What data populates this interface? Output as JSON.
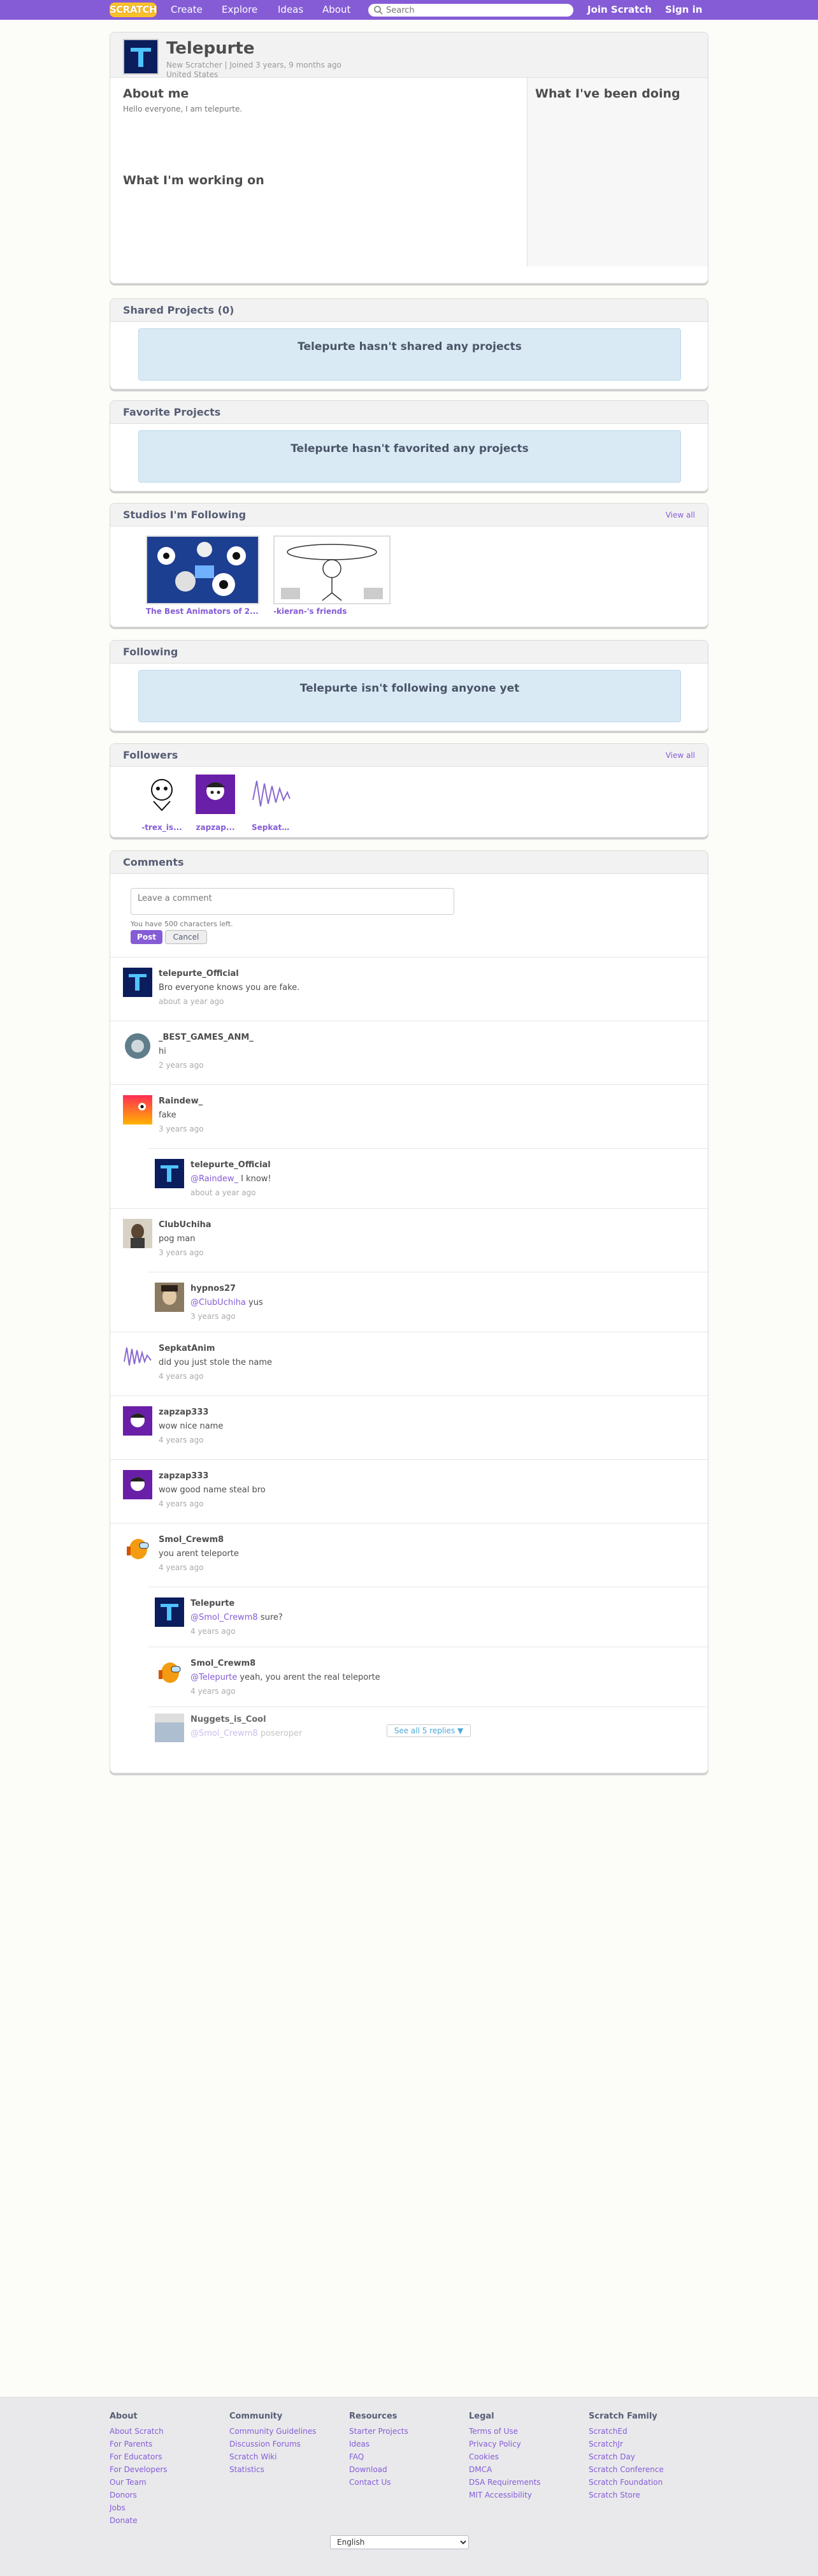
{
  "nav": {
    "logo": "SCRATCH",
    "create": "Create",
    "explore": "Explore",
    "ideas": "Ideas",
    "about": "About",
    "search_placeholder": "Search",
    "join": "Join Scratch",
    "signin": "Sign in"
  },
  "profile": {
    "username": "Telepurte",
    "status": "New Scratcher",
    "joined": "Joined 3 years, 9 months ago",
    "country": "United States",
    "about_title": "About me",
    "about_text": "Hello everyone, I am telepurte.",
    "working_title": "What I'm working on",
    "doing_title": "What I've been doing"
  },
  "shared": {
    "title": "Shared Projects (0)",
    "empty": "Telepurte hasn't shared any projects"
  },
  "favorites": {
    "title": "Favorite Projects",
    "empty": "Telepurte hasn't favorited any projects"
  },
  "studios": {
    "title": "Studios I'm Following",
    "view_all": "View all",
    "items": [
      {
        "name": "The Best Animators of 2..."
      },
      {
        "name": "-kieran-'s friends"
      }
    ]
  },
  "following": {
    "title": "Following",
    "empty": "Telepurte isn't following anyone yet"
  },
  "followers": {
    "title": "Followers",
    "view_all": "View all",
    "items": [
      {
        "name": "-trex_is..."
      },
      {
        "name": "zapzap..."
      },
      {
        "name": "SepkatA..."
      }
    ]
  },
  "comments": {
    "title": "Comments",
    "placeholder": "Leave a comment",
    "chars_left": "You have 500 characters left.",
    "post": "Post",
    "cancel": "Cancel",
    "see_all": "See all 5 replies",
    "items": [
      {
        "author": "telepurte_Official",
        "text": "Bro everyone knows you are fake.",
        "time": "about a year ago"
      },
      {
        "author": "_BEST_GAMES_ANM_",
        "text": "hi",
        "time": "2 years ago"
      },
      {
        "author": "Raindew_",
        "text": "fake",
        "time": "3 years ago"
      },
      {
        "author": "telepurte_Official",
        "mention": "@Raindew_",
        "text": " I know!",
        "time": "about a year ago"
      },
      {
        "author": "ClubUchiha",
        "text": "pog man",
        "time": "3 years ago"
      },
      {
        "author": "hypnos27",
        "mention": "@ClubUchiha",
        "text": " yus",
        "time": "3 years ago"
      },
      {
        "author": "SepkatAnim",
        "text": "did you just stole the name",
        "time": "4 years ago"
      },
      {
        "author": "zapzap333",
        "text": "wow nice name",
        "time": "4 years ago"
      },
      {
        "author": "zapzap333",
        "text": "wow good name steal bro",
        "time": "4 years ago"
      },
      {
        "author": "Smol_Crewm8",
        "text": "you arent teleporte",
        "time": "4 years ago"
      },
      {
        "author": "Telepurte",
        "mention": "@Smol_Crewm8",
        "text": " sure?",
        "time": "4 years ago"
      },
      {
        "author": "Smol_Crewm8",
        "mention": "@Telepurte",
        "text": " yeah, you arent the real teleporte",
        "time": "4 years ago"
      },
      {
        "author": "Nuggets_is_Cool",
        "mention": "@Smol_Crewm8",
        "text": " poseroper",
        "time": ""
      }
    ]
  },
  "footer": {
    "language": "English",
    "columns": [
      {
        "title": "About",
        "links": [
          "About Scratch",
          "For Parents",
          "For Educators",
          "For Developers",
          "Our Team",
          "Donors",
          "Jobs",
          "Donate"
        ]
      },
      {
        "title": "Community",
        "links": [
          "Community Guidelines",
          "Discussion Forums",
          "Scratch Wiki",
          "Statistics"
        ]
      },
      {
        "title": "Resources",
        "links": [
          "Starter Projects",
          "Ideas",
          "FAQ",
          "Download",
          "Contact Us"
        ]
      },
      {
        "title": "Legal",
        "links": [
          "Terms of Use",
          "Privacy Policy",
          "Cookies",
          "DMCA",
          "DSA Requirements",
          "MIT Accessibility"
        ]
      },
      {
        "title": "Scratch Family",
        "links": [
          "ScratchEd",
          "ScratchJr",
          "Scratch Day",
          "Scratch Conference",
          "Scratch Foundation",
          "Scratch Store"
        ]
      }
    ]
  },
  "colors": {
    "brand": "#855cd6",
    "link": "#855cd6",
    "info_box": "#d9eaf5"
  }
}
